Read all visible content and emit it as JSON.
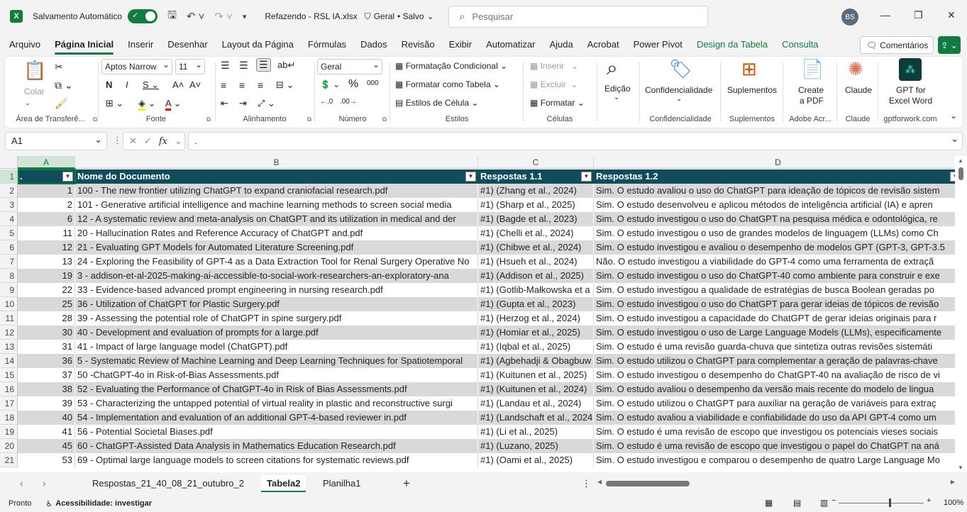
{
  "titlebar": {
    "autosave_label": "Salvamento Automático",
    "file_name": "Refazendo - RSL IA.xlsx",
    "sensitivity": "Geral",
    "save_state": "• Salvo",
    "search_placeholder": "Pesquisar",
    "user_initials": "BS"
  },
  "tabs": [
    "Arquivo",
    "Página Inicial",
    "Inserir",
    "Desenhar",
    "Layout da Página",
    "Fórmulas",
    "Dados",
    "Revisão",
    "Exibir",
    "Automatizar",
    "Ajuda",
    "Acrobat",
    "Power Pivot",
    "Design da Tabela",
    "Consulta"
  ],
  "comments_label": "Comentários",
  "ribbon": {
    "clipboard": {
      "paste": "Colar",
      "label": "Área de Transferê..."
    },
    "font": {
      "name": "Aptos Narrow",
      "size": "11",
      "label": "Fonte"
    },
    "alignment": {
      "label": "Alinhamento"
    },
    "number": {
      "format": "Geral",
      "label": "Número"
    },
    "styles": {
      "conditional": "Formatação Condicional",
      "as_table": "Formatar como Tabela",
      "cell_styles": "Estilos de Célula",
      "label": "Estilos"
    },
    "cells": {
      "insert": "Inserir",
      "delete": "Excluir",
      "format": "Formatar",
      "label": "Células"
    },
    "editing": {
      "label": "Edição"
    },
    "sensitivity": {
      "button": "Confidencialidade",
      "label": "Confidencialidade"
    },
    "addins": {
      "button": "Suplementos",
      "label": "Suplementos"
    },
    "adobe": {
      "button_line1": "Create",
      "button_line2": "a PDF",
      "label": "Adobe Acr..."
    },
    "claude": {
      "button": "Claude",
      "label": "Claude"
    },
    "gptforwork": {
      "button_line1": "GPT for",
      "button_line2": "Excel Word",
      "label": "gptforwork.com"
    }
  },
  "formula_bar": {
    "cell_ref": "A1",
    "content": "."
  },
  "columns": [
    "A",
    "B",
    "C",
    "D"
  ],
  "header_row": [
    ".",
    "Nome do Documento",
    "Respostas 1.1",
    "Respostas 1.2"
  ],
  "rows": [
    [
      "1",
      "100 - The new frontier utilizing ChatGPT to expand craniofacial research.pdf",
      "#1) (Zhang et al., 2024)",
      "Sim. O estudo avaliou o uso do ChatGPT para ideação de tópicos de revisão sistem"
    ],
    [
      "2",
      "101 - Generative artificial intelligence and machine learning methods to screen social media",
      "#1) (Sharp et al., 2025)",
      "Sim. O estudo desenvolveu e aplicou métodos de inteligência artificial (IA) e apren"
    ],
    [
      "6",
      "12 - A systematic review and meta-analysis on ChatGPT and its utilization in medical and der",
      "#1) (Bagde et al., 2023)",
      "Sim. O estudo investigou o uso do ChatGPT na pesquisa médica e odontológica, re"
    ],
    [
      "11",
      "20 - Hallucination Rates and Reference Accuracy of ChatGPT and.pdf",
      "#1) (Chelli et al., 2024)",
      "Sim. O estudo investigou o uso de grandes modelos de linguagem (LLMs) como Ch"
    ],
    [
      "12",
      "21 - Evaluating GPT Models for Automated Literature Screening.pdf",
      "#1) (Chibwe et al., 2024)",
      "Sim. O estudo investigou e avaliou o desempenho de modelos GPT (GPT-3, GPT-3.5"
    ],
    [
      "13",
      "24 - Exploring the Feasibility of GPT-4 as a Data Extraction Tool for Renal Surgery Operative No",
      "#1) (Hsueh et al., 2024)",
      "Não. O estudo investigou a viabilidade do GPT-4 como uma ferramenta de extraçã"
    ],
    [
      "19",
      "3 - addison-et-al-2025-making-ai-accessible-to-social-work-researchers-an-exploratory-ana",
      "#1) (Addison et al., 2025)",
      "Sim. O estudo investigou o uso do ChatGPT-40 como ambiente para construir e exe"
    ],
    [
      "22",
      "33 - Evidence-based advanced prompt engineering in nursing research.pdf",
      "#1) (Gotlib-Małkowska et a",
      "Sim. O estudo investigou a qualidade de estratégias de busca Boolean geradas po"
    ],
    [
      "25",
      "36 - Utilization of ChatGPT for Plastic Surgery.pdf",
      "#1) (Gupta et al., 2023)",
      "Sim. O estudo investigou o uso do ChatGPT para gerar ideias de tópicos de revisão"
    ],
    [
      "28",
      "39 - Assessing the potential role of ChatGPT in spine surgery.pdf",
      "#1) (Herzog et al., 2024)",
      "Sim. O estudo investigou a capacidade do ChatGPT de gerar ideias originais para r"
    ],
    [
      "30",
      "40 - Development and evaluation of prompts for a large.pdf",
      "#1) (Homiar et al., 2025)",
      "Sim. O estudo investigou o uso de Large Language Models (LLMs), especificamente"
    ],
    [
      "31",
      "41 - Impact of large language model (ChatGPT).pdf",
      "#1) (Iqbal et al., 2025)",
      "Sim. O estudo é uma revisão guarda-chuva que sintetiza outras revisões sistemáti"
    ],
    [
      "36",
      "5 - Systematic Review of Machine Learning and Deep Learning Techniques for Spatiotemporal",
      "#1) (Agbehadji & Obagbuw",
      "Sim. O estudo utilizou o ChatGPT para complementar a geração de palavras-chave"
    ],
    [
      "37",
      "50 -ChatGPT-4o in Risk-of-Bias Assessments.pdf",
      "#1) (Kuitunen et al., 2025)",
      "Sim. O estudo investigou o desempenho do ChatGPT-40 na avaliação de risco de vi"
    ],
    [
      "38",
      "52 - Evaluating the Performance of ChatGPT-4o in Risk of Bias Assessments.pdf",
      "#1) (Kuitunen et al., 2024)",
      "Sim. O estudo avaliou o desempenho da versão mais recente do modelo de lingua"
    ],
    [
      "39",
      "53 - Characterizing the untapped potential of virtual reality in plastic and reconstructive surgi",
      "#1) (Landau et al., 2024)",
      "Sim. O estudo utilizou o ChatGPT para auxiliar na geração de variáveis para extraç"
    ],
    [
      "40",
      "54 - Implementation and evaluation of an additional GPT-4-based reviewer in.pdf",
      "#1) (Landschaft et al., 2024",
      "Sim. O estudo avaliou a viabilidade e confiabilidade do uso da API GPT-4 como um"
    ],
    [
      "41",
      "56 - Potential Societal Biases.pdf",
      "#1) (Li et al., 2025)",
      "Sim. O estudo é uma revisão de escopo que investigou os potenciais vieses sociais"
    ],
    [
      "45",
      "60 - ChatGPT-Assisted Data Analysis in Mathematics Education Research.pdf",
      "#1) (Luzano, 2025)",
      "Sim. O estudo é uma revisão de escopo que investigou o papel do ChatGPT na aná"
    ],
    [
      "53",
      "69 - Optimal large language models to screen citations for systematic reviews.pdf",
      "#1) (Oami et al., 2025)",
      "Sim. O estudo investigou e comparou o desempenho de quatro Large Language Mo"
    ]
  ],
  "row_numbers": [
    "1",
    "2",
    "3",
    "4",
    "5",
    "6",
    "7",
    "8",
    "9",
    "10",
    "11",
    "12",
    "13",
    "14",
    "15",
    "16",
    "17",
    "18",
    "19",
    "20",
    "21"
  ],
  "sheets": [
    "Respostas_21_40_08_21_outubro_2",
    "Tabela2",
    "Planilha1"
  ],
  "active_sheet": "Tabela2",
  "status": {
    "ready": "Pronto",
    "accessibility": "Acessibilidade: investigar",
    "zoom": "100%"
  }
}
